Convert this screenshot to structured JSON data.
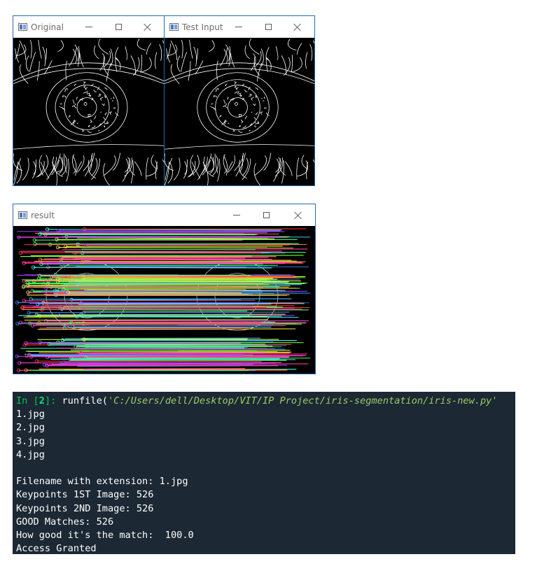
{
  "windows": {
    "original": {
      "title": "Original"
    },
    "test_input": {
      "title": "Test Input"
    },
    "result": {
      "title": "result"
    }
  },
  "window_controls": {
    "minimize": "minimize-icon",
    "maximize": "maximize-icon",
    "close": "close-icon"
  },
  "console": {
    "prompt_prefix": "In [",
    "prompt_number": "2",
    "prompt_suffix": "]:",
    "command_fn": " runfile(",
    "command_path": "'C:/Users/dell/Desktop/VIT/IP Project/iris-segmentation/iris-new.py'",
    "files": [
      "1.jpg",
      "2.jpg",
      "3.jpg",
      "4.jpg"
    ],
    "blank": "",
    "filename_line": "Filename with extension: 1.jpg",
    "kp1_line": "Keypoints 1ST Image: 526",
    "kp2_line": "Keypoints 2ND Image: 526",
    "good_line": "GOOD Matches: 526",
    "match_line": "How good it's the match:  100.0",
    "result_line": "Access Granted"
  },
  "colors": {
    "console_bg": "#1c2833",
    "window_border": "#1f6fb2",
    "prompt": "#00c853",
    "path": "#9ccc65"
  }
}
